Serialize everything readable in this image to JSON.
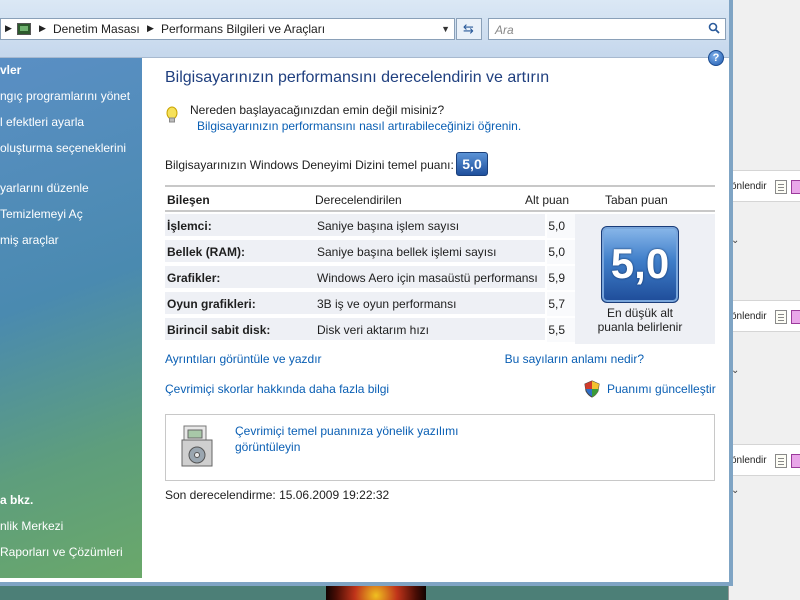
{
  "address": {
    "crumbs": [
      "Denetim Masası",
      "Performans Bilgileri ve Araçları"
    ],
    "search_placeholder": "Ara"
  },
  "sidebar": {
    "items": [
      {
        "label": "vler",
        "bold": true
      },
      {
        "label": "ngıç programlarını yönet"
      },
      {
        "label": "l efektleri ayarla"
      },
      {
        "label": "oluşturma seçeneklerini"
      },
      {
        "label": "yarlarını düzenle"
      },
      {
        "label": "Temizlemeyi Aç"
      },
      {
        "label": "miş araçlar"
      }
    ],
    "see_also_title": "a bkz.",
    "see_also_items": [
      "nlik Merkezi",
      "Raporları ve Çözümleri"
    ]
  },
  "main": {
    "title": "Bilgisayarınızın performansını derecelendirin ve artırın",
    "tip_question": "Nereden başlayacağınızdan emin değil misiniz?",
    "tip_link": "Bilgisayarınızın performansını nasıl artırabileceğinizi öğrenin.",
    "base_score_label": "Bilgisayarınızın Windows Deneyimi Dizini temel puanı:",
    "base_score": "5,0",
    "table": {
      "headers": [
        "Bileşen",
        "Derecelendirilen",
        "Alt puan",
        "Taban puan"
      ],
      "rows": [
        {
          "component": "İşlemci:",
          "rated": "Saniye başına işlem sayısı",
          "subscore": "5,0"
        },
        {
          "component": "Bellek (RAM):",
          "rated": "Saniye başına bellek işlemi sayısı",
          "subscore": "5,0"
        },
        {
          "component": "Grafikler:",
          "rated": "Windows Aero için masaüstü performansı",
          "subscore": "5,9"
        },
        {
          "component": "Oyun grafikleri:",
          "rated": "3B iş ve oyun performansı",
          "subscore": "5,7"
        },
        {
          "component": "Birincil sabit disk:",
          "rated": "Disk veri aktarım hızı",
          "subscore": "5,5"
        }
      ],
      "base_score_big": "5,0",
      "base_caption": "En düşük alt puanla belirlenir"
    },
    "links": {
      "view_print": "Ayrıntıları görüntüle ve yazdır",
      "what_mean": "Bu sayıların anlamı nedir?",
      "online_scores": "Çevrimiçi skorlar hakkında daha fazla bilgi",
      "update_score": "Puanımı güncelleştir"
    },
    "online_software": "Çevrimiçi temel puanınıza yönelik yazılımı görüntüleyin",
    "last_rated": "Son derecelendirme: 15.06.2009 19:22:32"
  },
  "background_window": {
    "row_label": "önlendir"
  }
}
